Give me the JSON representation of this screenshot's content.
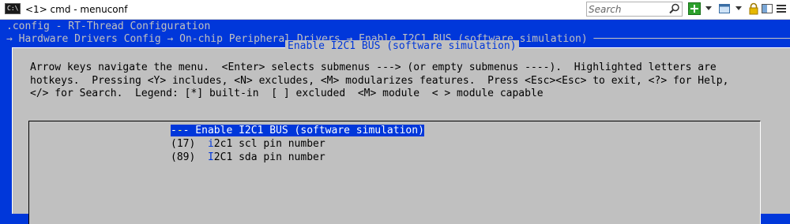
{
  "window": {
    "icon_text": "C:\\",
    "title": "<1> cmd - menuconf",
    "search_placeholder": "Search"
  },
  "icons": {
    "app": "console-icon",
    "search": "search-icon",
    "new_tab": "plus-icon",
    "view": "window-icon",
    "lock": "lock-icon",
    "panels": "panels-icon",
    "menu": "hamburger-icon"
  },
  "colors": {
    "background": "#0037da",
    "dialog": "#c0c0c0",
    "highlight": "#0037da",
    "hotkey": "#0037da",
    "terminal_text": "#c0c0c0"
  },
  "terminal": {
    "config_line": ".config - RT-Thread Configuration",
    "breadcrumb": "→ Hardware Drivers Config → On-chip Peripheral Drivers → Enable I2C1 BUS (software simulation) ─────────────────────────────────"
  },
  "dialog": {
    "title": "Enable I2C1 BUS (software simulation)",
    "help_lines": [
      "Arrow keys navigate the menu.  <Enter> selects submenus ---> (or empty submenus ----).  Highlighted letters are",
      "hotkeys.  Pressing <Y> includes, <N> excludes, <M> modularizes features.  Press <Esc><Esc> to exit, <?> for Help,",
      "</> for Search.  Legend: [*] built-in  [ ] excluded  <M> module  < > module capable"
    ]
  },
  "menu": {
    "items": [
      {
        "prefix": "-",
        "hotkey": "-",
        "rest": "- Enable I2C1 BUS (software simulation)",
        "selected": true
      },
      {
        "prefix": "(17)  ",
        "hotkey": "i",
        "rest": "2c1 scl pin number",
        "selected": false
      },
      {
        "prefix": "(89)  ",
        "hotkey": "I",
        "rest": "2C1 sda pin number",
        "selected": false
      }
    ]
  }
}
